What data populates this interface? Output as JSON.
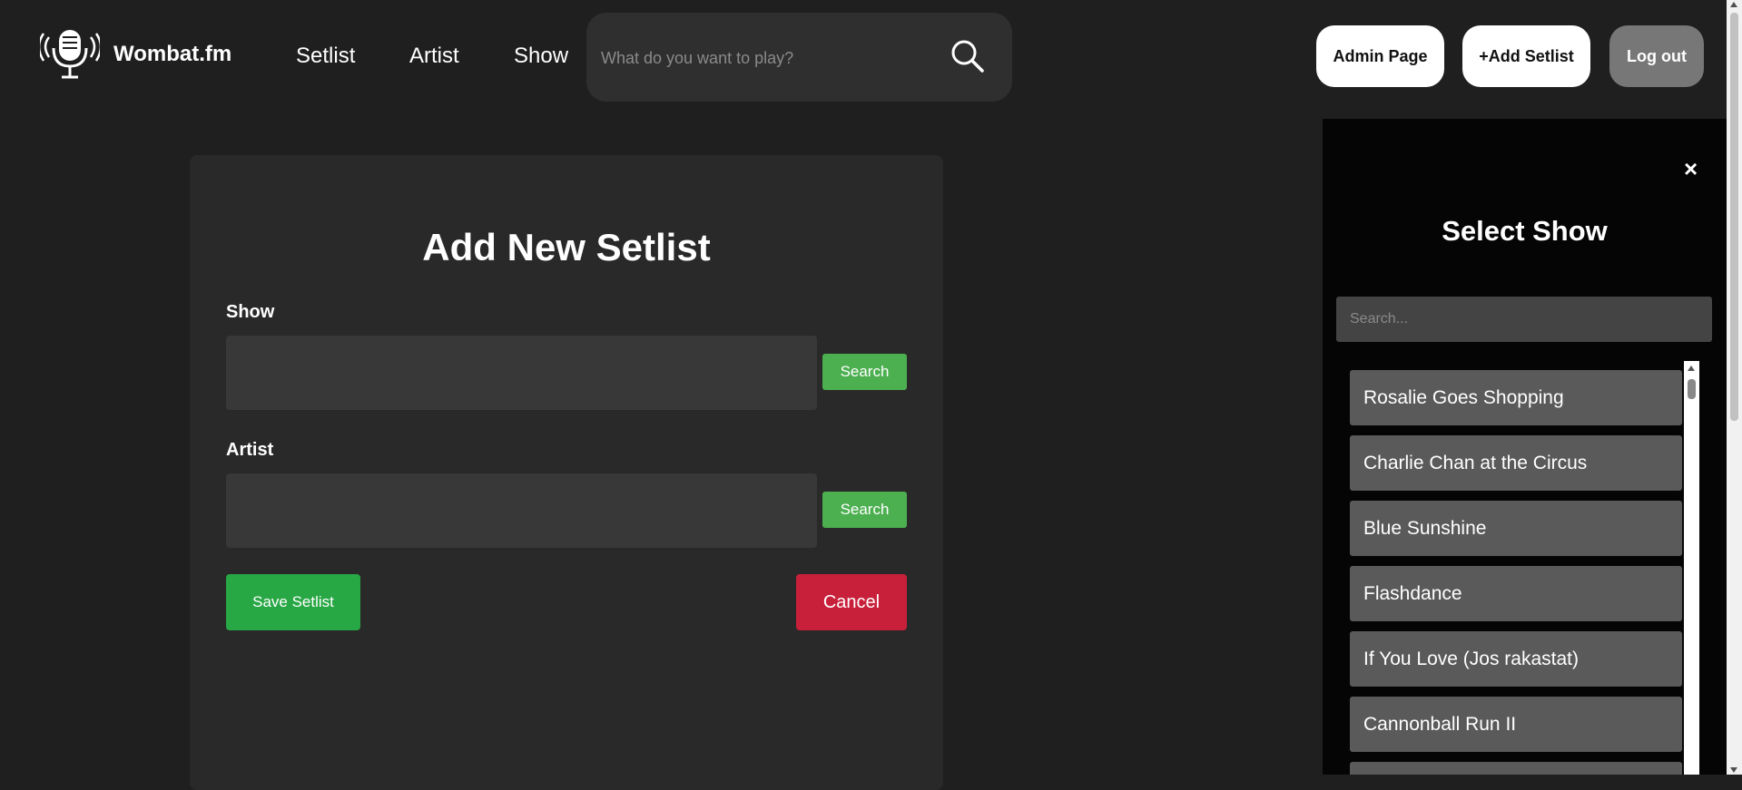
{
  "header": {
    "brand": "Wombat.fm",
    "nav": [
      "Setlist",
      "Artist",
      "Show"
    ],
    "search_placeholder": "What do you want to play?",
    "admin_label": "Admin Page",
    "add_setlist_label": "+Add Setlist",
    "logout_label": "Log out"
  },
  "form": {
    "title": "Add New Setlist",
    "show_label": "Show",
    "show_value": "",
    "artist_label": "Artist",
    "artist_value": "",
    "search_label": "Search",
    "save_label": "Save Setlist",
    "cancel_label": "Cancel"
  },
  "panel": {
    "close_glyph": "×",
    "title": "Select Show",
    "search_placeholder": "Search...",
    "shows": [
      "Rosalie Goes Shopping",
      "Charlie Chan at the Circus",
      "Blue Sunshine",
      "Flashdance",
      "If You Love (Jos rakastat)",
      "Cannonball Run II"
    ]
  },
  "colors": {
    "background": "#1f1f1f",
    "card": "#292929",
    "search_button": "#4caf50",
    "save_button": "#28a745",
    "cancel_button": "#c8203a",
    "panel": "#050505",
    "list_item": "#5a5a5a"
  }
}
